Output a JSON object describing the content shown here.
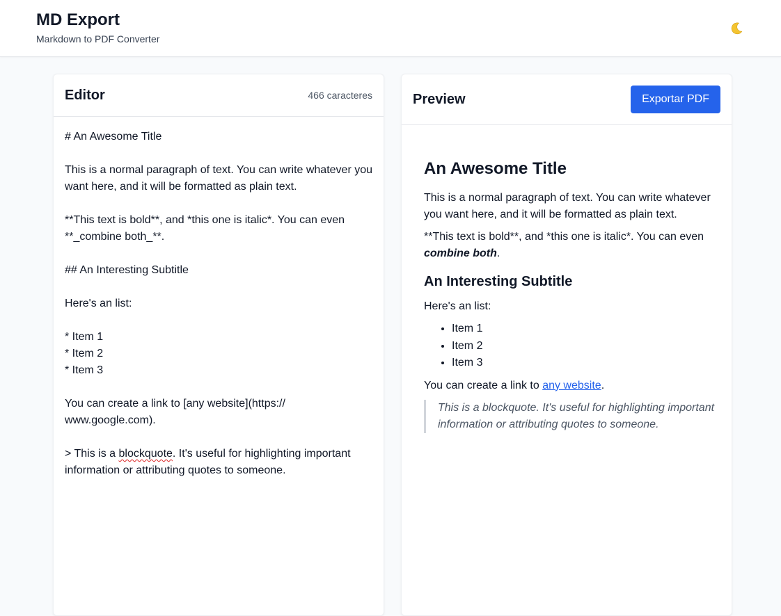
{
  "header": {
    "title": "MD Export",
    "subtitle": "Markdown to PDF Converter",
    "theme_icon": "moon-icon",
    "theme_glyph": "🌙"
  },
  "editor": {
    "title": "Editor",
    "char_count": "466",
    "char_label": "caracteres",
    "lines": [
      "# An Awesome Title",
      "",
      "This is a normal paragraph of text. You can write whatever you",
      "want here, and it will be formatted as plain text.",
      "",
      "**This text is bold**, and *this one is italic*. You can even",
      "**_combine both_**.",
      "",
      "## An Interesting Subtitle",
      "",
      "Here's an list:",
      "",
      "* Item 1",
      "* Item 2",
      "* Item 3",
      "",
      "You can create a link to [any website](https://",
      "www.google.com).",
      "",
      "> This is a blockquote. It's useful for highlighting important",
      "information or attributing quotes to someone."
    ],
    "misspelled_word": "blockquote"
  },
  "preview": {
    "title": "Preview",
    "export_label": "Exportar PDF",
    "h1": "An Awesome Title",
    "paragraph": "This is a normal paragraph of text. You can write whatever you want here, and it will be formatted as plain text.",
    "emphasis_text": "**This text is bold**, and *this one is italic*. You can even ",
    "emphasis_strong": "combine both",
    "emphasis_end": ".",
    "h2": "An Interesting Subtitle",
    "list_intro": "Here's an list:",
    "list_items": [
      "Item 1",
      "Item 2",
      "Item 3"
    ],
    "link_prefix": "You can create a link to ",
    "link_text": "any website",
    "link_suffix": ".",
    "blockquote": "This is a blockquote. It's useful for highlighting important information or attributing quotes to someone."
  },
  "colors": {
    "accent": "#2563eb",
    "background": "#f8fafc",
    "panel": "#ffffff",
    "text": "#111827",
    "muted": "#4b5563"
  }
}
